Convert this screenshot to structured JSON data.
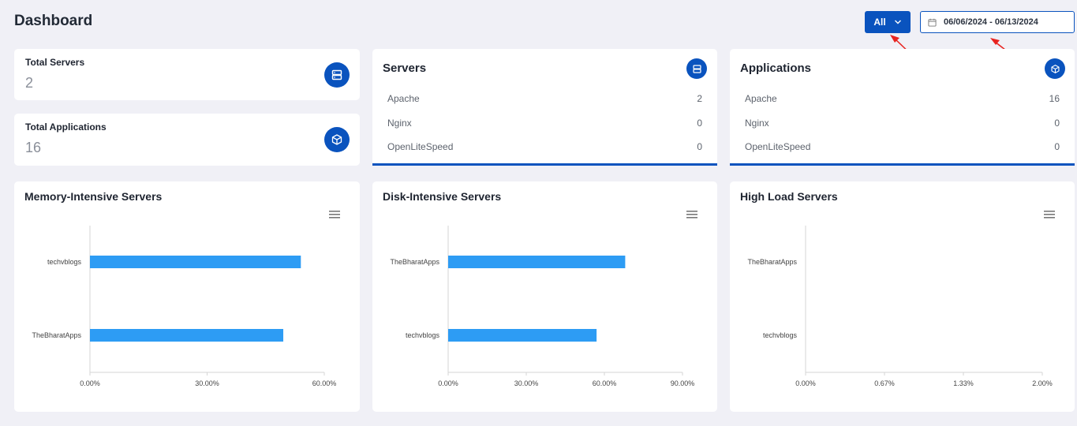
{
  "header": {
    "title": "Dashboard",
    "filter_label": "All",
    "date_range": "06/06/2024 - 06/13/2024"
  },
  "stats": [
    {
      "label": "Total Servers",
      "value": "2",
      "icon": "server-icon"
    },
    {
      "label": "Total Applications",
      "value": "16",
      "icon": "cube-icon"
    }
  ],
  "servers": {
    "title": "Servers",
    "icon": "server-icon",
    "rows": [
      {
        "name": "Apache",
        "count": "2"
      },
      {
        "name": "Nginx",
        "count": "0"
      },
      {
        "name": "OpenLiteSpeed",
        "count": "0"
      }
    ]
  },
  "applications": {
    "title": "Applications",
    "icon": "cube-icon",
    "rows": [
      {
        "name": "Apache",
        "count": "16"
      },
      {
        "name": "Nginx",
        "count": "0"
      },
      {
        "name": "OpenLiteSpeed",
        "count": "0"
      }
    ]
  },
  "colors": {
    "accent": "#0a53be",
    "bar": "#2d9cf4",
    "background": "#f0f0f6"
  },
  "chart_data": [
    {
      "type": "bar",
      "orientation": "horizontal",
      "title": "Memory-Intensive Servers",
      "categories": [
        "techvblogs",
        "TheBharatApps"
      ],
      "values": [
        54,
        49.5
      ],
      "xlim": [
        0,
        60
      ],
      "xticks": [
        "0.00%",
        "30.00%",
        "60.00%"
      ],
      "unit": "%"
    },
    {
      "type": "bar",
      "orientation": "horizontal",
      "title": "Disk-Intensive Servers",
      "categories": [
        "TheBharatApps",
        "techvblogs"
      ],
      "values": [
        68,
        57
      ],
      "xlim": [
        0,
        90
      ],
      "xticks": [
        "0.00%",
        "30.00%",
        "60.00%",
        "90.00%"
      ],
      "unit": "%"
    },
    {
      "type": "bar",
      "orientation": "horizontal",
      "title": "High Load Servers",
      "categories": [
        "TheBharatApps",
        "techvblogs"
      ],
      "values": [
        0,
        0
      ],
      "xlim": [
        0,
        2
      ],
      "xticks": [
        "0.00%",
        "0.67%",
        "1.33%",
        "2.00%"
      ],
      "unit": "%"
    }
  ]
}
